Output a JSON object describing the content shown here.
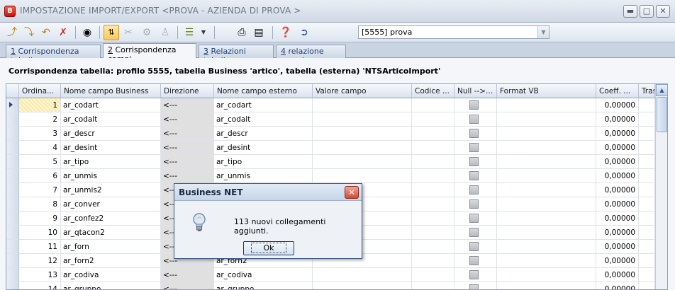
{
  "window": {
    "title": "IMPOSTAZIONE IMPORT/EXPORT <PROVA - AZIENDA DI PROVA >",
    "app_icon": "B"
  },
  "toolbar": {
    "profile_value": "[5555] prova"
  },
  "tabs": [
    {
      "key": "1",
      "label": " Corrispondenza tabelle"
    },
    {
      "key": "2",
      "label": " Corrispondenza campi"
    },
    {
      "key": "3",
      "label": " Relazioni tabelle"
    },
    {
      "key": "4",
      "label": " relazione campi"
    }
  ],
  "active_tab": 1,
  "heading": "Corrispondenza tabella: profilo 5555, tabella Business 'artico', tabella (esterna) 'NTSArticoImport'",
  "grid": {
    "columns": [
      "Ordina...",
      "Nome campo Business",
      "Direzione",
      "Nome campo esterno",
      "Valore campo",
      "Codice ...",
      "Null -->...",
      "Format VB",
      "Coeff. ...",
      "Tras"
    ],
    "rows": [
      {
        "ord": "1",
        "business": "ar_codart",
        "dir": "<---",
        "esterno": "ar_codart",
        "coeff": "0,00000"
      },
      {
        "ord": "2",
        "business": "ar_codalt",
        "dir": "<---",
        "esterno": "ar_codalt",
        "coeff": "0,00000"
      },
      {
        "ord": "3",
        "business": "ar_descr",
        "dir": "<---",
        "esterno": "ar_descr",
        "coeff": "0,00000"
      },
      {
        "ord": "4",
        "business": "ar_desint",
        "dir": "<---",
        "esterno": "ar_desint",
        "coeff": "0,00000"
      },
      {
        "ord": "5",
        "business": "ar_tipo",
        "dir": "<---",
        "esterno": "ar_tipo",
        "coeff": "0,00000"
      },
      {
        "ord": "6",
        "business": "ar_unmis",
        "dir": "<---",
        "esterno": "ar_unmis",
        "coeff": "0,00000"
      },
      {
        "ord": "7",
        "business": "ar_unmis2",
        "dir": "<---",
        "esterno": "",
        "coeff": "0,00000"
      },
      {
        "ord": "8",
        "business": "ar_conver",
        "dir": "<---",
        "esterno": "",
        "coeff": "0,00000"
      },
      {
        "ord": "9",
        "business": "ar_confez2",
        "dir": "<---",
        "esterno": "",
        "coeff": "0,00000"
      },
      {
        "ord": "10",
        "business": "ar_qtacon2",
        "dir": "<---",
        "esterno": "",
        "coeff": "0,00000"
      },
      {
        "ord": "11",
        "business": "ar_forn",
        "dir": "<---",
        "esterno": "",
        "coeff": "0,00000"
      },
      {
        "ord": "12",
        "business": "ar_forn2",
        "dir": "<---",
        "esterno": "ar_forn2",
        "coeff": "0,00000"
      },
      {
        "ord": "13",
        "business": "ar_codiva",
        "dir": "<---",
        "esterno": "ar_codiva",
        "coeff": "0,00000"
      },
      {
        "ord": "14",
        "business": "ar_gruppo",
        "dir": "<---",
        "esterno": "ar_gruppo",
        "coeff": "0,00000"
      }
    ]
  },
  "dialog": {
    "title": "Business NET",
    "message": "113 nuovi collegamenti aggiunti.",
    "ok_label": "Ok"
  }
}
